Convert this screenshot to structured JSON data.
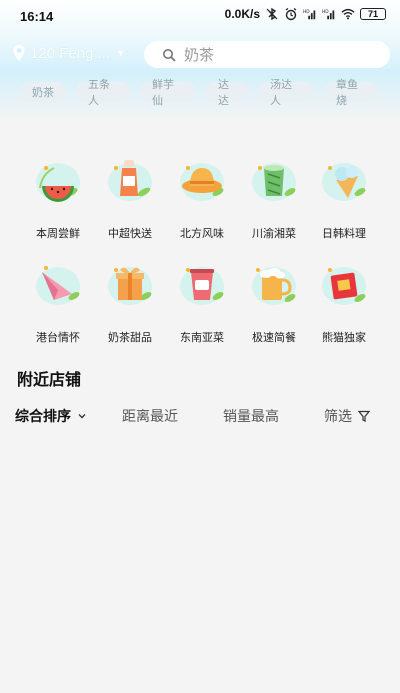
{
  "status_bar": {
    "time": "16:14",
    "network_speed": "0.0K/s",
    "battery": "71"
  },
  "header": {
    "location": "120 Feng ...",
    "search_placeholder": "奶茶"
  },
  "hot_tags": [
    "奶茶",
    "五条人",
    "鲜芋仙",
    "达达",
    "汤达人",
    "章鱼烧"
  ],
  "categories": [
    {
      "label": "本周尝鲜",
      "icon": "watermelon-icon"
    },
    {
      "label": "中超快送",
      "icon": "bottle-drink-icon"
    },
    {
      "label": "北方风味",
      "icon": "straw-hat-icon"
    },
    {
      "label": "川渝湘菜",
      "icon": "green-cup-icon"
    },
    {
      "label": "日韩料理",
      "icon": "ice-cream-icon"
    },
    {
      "label": "港台情怀",
      "icon": "paper-plane-icon"
    },
    {
      "label": "奶茶甜品",
      "icon": "gift-box-icon"
    },
    {
      "label": "东南亚菜",
      "icon": "milk-tea-cup-icon"
    },
    {
      "label": "极速简餐",
      "icon": "beer-mug-icon"
    },
    {
      "label": "熊猫独家",
      "icon": "red-envelope-icon"
    }
  ],
  "section": {
    "nearby_title": "附近店铺"
  },
  "sort_bar": {
    "comprehensive": "综合排序",
    "distance": "距离最近",
    "sales": "销量最高",
    "filter": "筛选"
  },
  "colors": {
    "accent_sky": "#d4f0fb",
    "chip_bg": "#e9eff2",
    "chip_text": "#8fa4ad",
    "page_bg": "#f4f4f4"
  }
}
